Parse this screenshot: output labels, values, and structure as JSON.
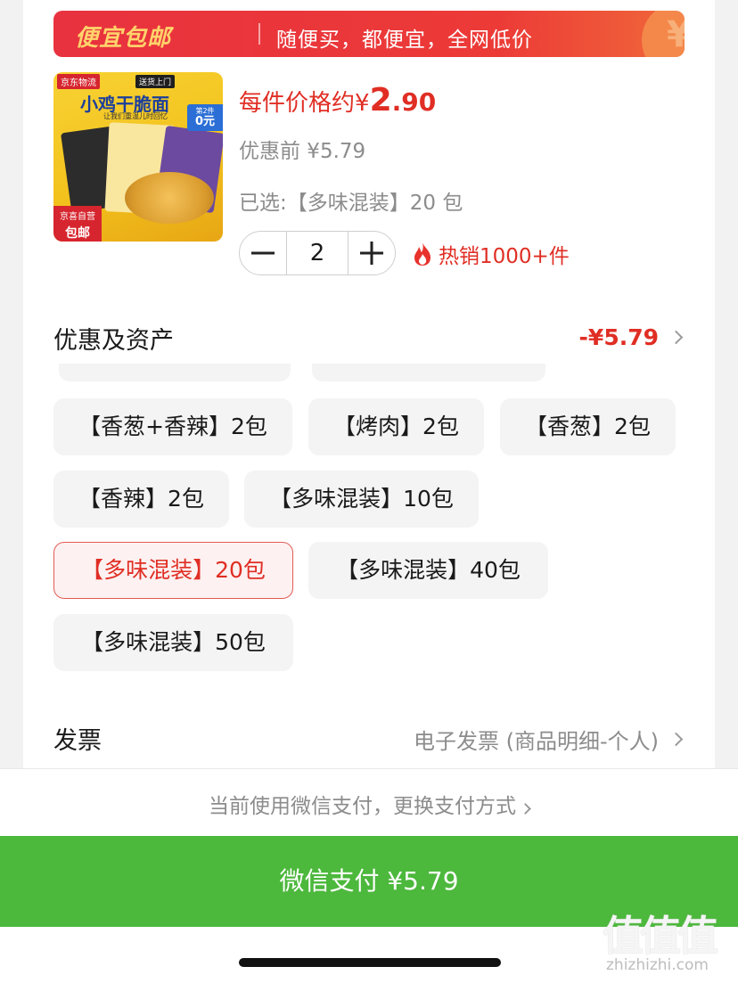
{
  "banner": {
    "title": "便宜包邮",
    "subtitle": "随便买，都便宜，全网低价",
    "icon": "yen-icon"
  },
  "product": {
    "image": {
      "logistics_tag": "京东物流",
      "delivery_tag": "送货上门",
      "name": "小鸡干脆面",
      "slogan": "让我们重温儿时回忆",
      "second_item_line1": "第2件",
      "second_item_line2": "0元",
      "self_run_line1": "京喜自营",
      "self_run_line2": "包邮"
    },
    "price_prefix": "每件价格约",
    "price_currency": "¥",
    "price_int": "2",
    "price_dec": ".90",
    "original_price": "优惠前 ¥5.79",
    "selected_spec": "已选:【多味混装】20 包",
    "quantity": "2",
    "hot_sales": "热销1000+件"
  },
  "discount": {
    "label": "优惠及资产",
    "value": "-¥5.79",
    "value_color": "#e02e24"
  },
  "specs": [
    {
      "label": "【香葱+香辣】2包",
      "selected": false
    },
    {
      "label": "【烤肉】2包",
      "selected": false
    },
    {
      "label": "【香葱】2包",
      "selected": false
    },
    {
      "label": "【香辣】2包",
      "selected": false
    },
    {
      "label": "【多味混装】10包",
      "selected": false
    },
    {
      "label": "【多味混装】20包",
      "selected": true
    },
    {
      "label": "【多味混装】40包",
      "selected": false
    },
    {
      "label": "【多味混装】50包",
      "selected": false
    }
  ],
  "invoice": {
    "label": "发票",
    "value": "电子发票 (商品明细-个人)"
  },
  "payment": {
    "switch_text": "当前使用微信支付，更换支付方式",
    "pay_button": "微信支付 ¥5.79",
    "pay_color": "#4cb83c"
  },
  "watermark": {
    "text": "值值值",
    "url": "zhizhizhi.com"
  }
}
